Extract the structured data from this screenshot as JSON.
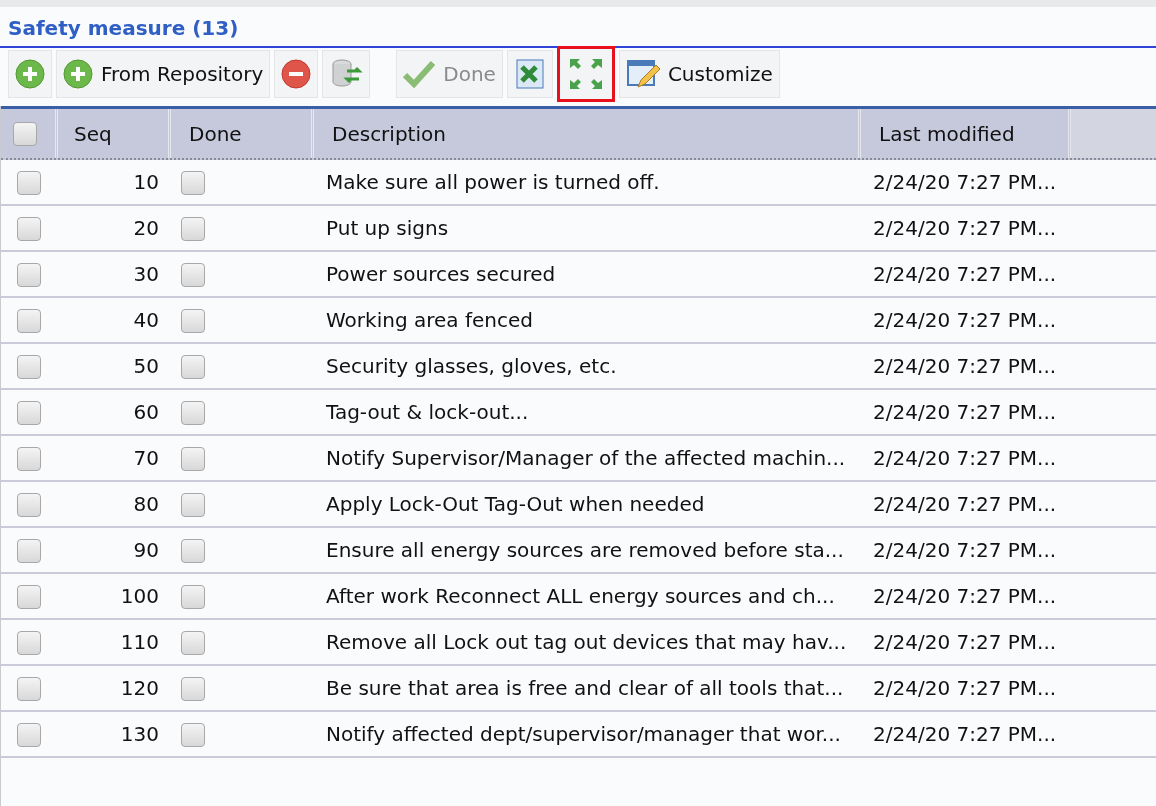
{
  "panel": {
    "title": "Safety measure (13)"
  },
  "toolbar": [
    {
      "kind": "add",
      "disabled": false,
      "highlighted": false
    },
    {
      "kind": "add",
      "label": "From Repository",
      "disabled": false,
      "highlighted": false
    },
    {
      "kind": "remove",
      "disabled": false,
      "highlighted": false
    },
    {
      "kind": "sync",
      "disabled": false,
      "highlighted": false
    },
    {
      "kind": "check",
      "label": "Done",
      "disabled": true,
      "highlighted": false
    },
    {
      "kind": "spreadsheet",
      "disabled": false,
      "highlighted": false
    },
    {
      "kind": "expand",
      "disabled": false,
      "highlighted": true
    },
    {
      "kind": "customize",
      "label": "Customize",
      "disabled": false,
      "highlighted": false
    }
  ],
  "table": {
    "select_all_checked": false,
    "columns": [
      "Seq",
      "Done",
      "Description",
      "Last modified"
    ],
    "rows": [
      {
        "checked": false,
        "seq": "10",
        "done": false,
        "description": "Make sure all power is turned off.",
        "last_modified": "2/24/20 7:27 PM..."
      },
      {
        "checked": false,
        "seq": "20",
        "done": false,
        "description": "Put up signs",
        "last_modified": "2/24/20 7:27 PM..."
      },
      {
        "checked": false,
        "seq": "30",
        "done": false,
        "description": "Power sources secured",
        "last_modified": "2/24/20 7:27 PM..."
      },
      {
        "checked": false,
        "seq": "40",
        "done": false,
        "description": "Working area fenced",
        "last_modified": "2/24/20 7:27 PM..."
      },
      {
        "checked": false,
        "seq": "50",
        "done": false,
        "description": "Security glasses, gloves, etc.",
        "last_modified": "2/24/20 7:27 PM..."
      },
      {
        "checked": false,
        "seq": "60",
        "done": false,
        "description": "Tag-out & lock-out...",
        "last_modified": "2/24/20 7:27 PM..."
      },
      {
        "checked": false,
        "seq": "70",
        "done": false,
        "description": "Notify Supervisor/Manager of the affected machin...",
        "last_modified": "2/24/20 7:27 PM..."
      },
      {
        "checked": false,
        "seq": "80",
        "done": false,
        "description": "Apply Lock-Out Tag-Out when needed",
        "last_modified": "2/24/20 7:27 PM..."
      },
      {
        "checked": false,
        "seq": "90",
        "done": false,
        "description": "Ensure all energy sources are removed before sta...",
        "last_modified": "2/24/20 7:27 PM..."
      },
      {
        "checked": false,
        "seq": "100",
        "done": false,
        "description": "After work Reconnect ALL energy sources and ch...",
        "last_modified": "2/24/20 7:27 PM..."
      },
      {
        "checked": false,
        "seq": "110",
        "done": false,
        "description": "Remove all Lock out tag out devices that may hav...",
        "last_modified": "2/24/20 7:27 PM..."
      },
      {
        "checked": false,
        "seq": "120",
        "done": false,
        "description": "Be sure that area is free and clear of all tools that...",
        "last_modified": "2/24/20 7:27 PM..."
      },
      {
        "checked": false,
        "seq": "130",
        "done": false,
        "description": "Notify affected dept/supervisor/manager that wor...",
        "last_modified": "2/24/20 7:27 PM..."
      }
    ]
  }
}
